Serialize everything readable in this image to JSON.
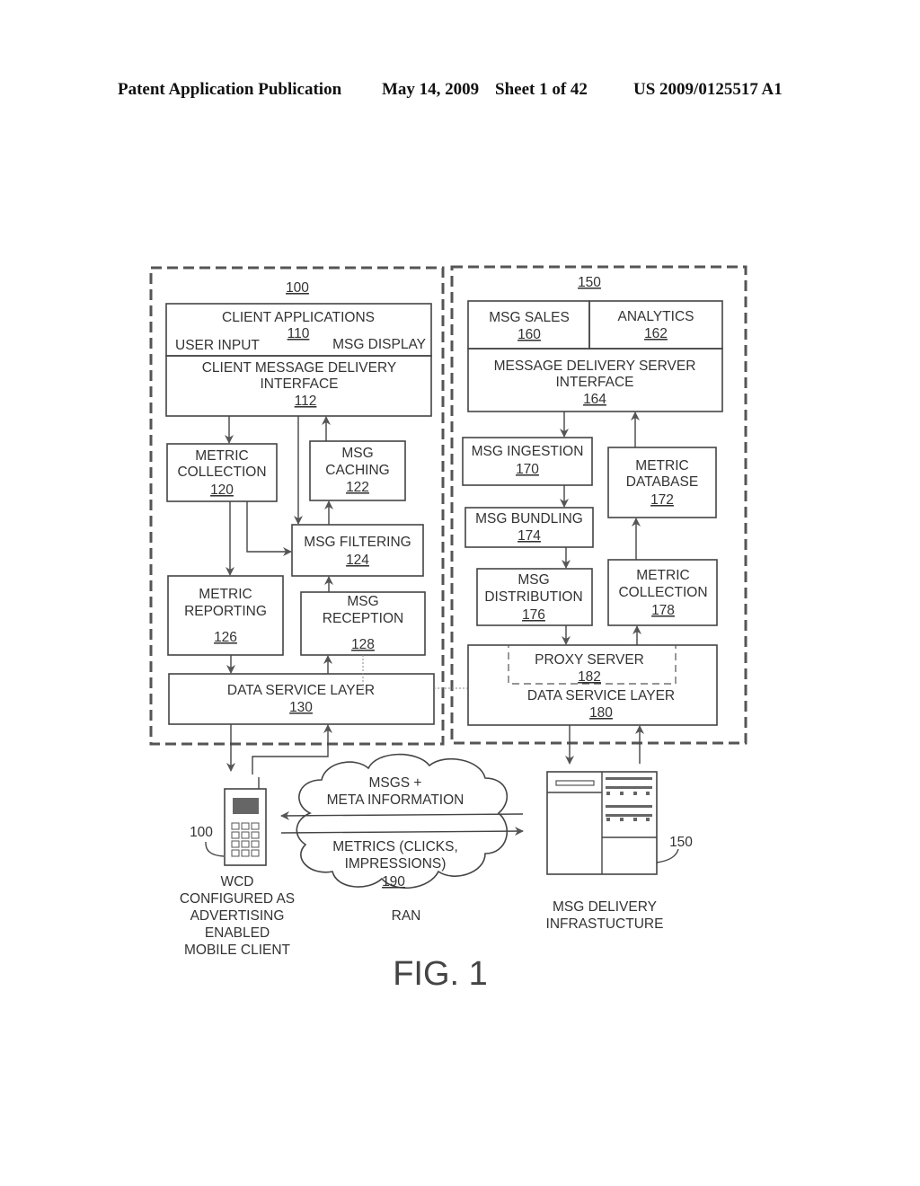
{
  "header": {
    "publication": "Patent Application Publication",
    "date": "May 14, 2009",
    "sheet": "Sheet 1 of 42",
    "number": "US 2009/0125517 A1"
  },
  "client": {
    "ref": "100",
    "apps": {
      "title": "CLIENT APPLICATIONS",
      "ref": "110",
      "left": "USER INPUT",
      "right": "MSG DISPLAY"
    },
    "interface": {
      "line1": "CLIENT MESSAGE DELIVERY",
      "line2": "INTERFACE",
      "ref": "112"
    },
    "metric_collection": {
      "line1": "METRIC",
      "line2": "COLLECTION",
      "ref": "120"
    },
    "msg_caching": {
      "line1": "MSG",
      "line2": "CACHING",
      "ref": "122"
    },
    "msg_filtering": {
      "line1": "MSG FILTERING",
      "ref": "124"
    },
    "metric_reporting": {
      "line1": "METRIC",
      "line2": "REPORTING",
      "ref": "126"
    },
    "msg_reception": {
      "line1": "MSG",
      "line2": "RECEPTION",
      "ref": "128"
    },
    "data_service": {
      "line1": "DATA SERVICE LAYER",
      "ref": "130"
    }
  },
  "server": {
    "ref": "150",
    "msg_sales": {
      "line1": "MSG SALES",
      "ref": "160"
    },
    "analytics": {
      "line1": "ANALYTICS",
      "ref": "162"
    },
    "interface": {
      "line1": "MESSAGE DELIVERY SERVER",
      "line2": "INTERFACE",
      "ref": "164"
    },
    "msg_ingestion": {
      "line1": "MSG INGESTION",
      "ref": "170"
    },
    "metric_database": {
      "line1": "METRIC",
      "line2": "DATABASE",
      "ref": "172"
    },
    "msg_bundling": {
      "line1": "MSG BUNDLING",
      "ref": "174"
    },
    "msg_distribution": {
      "line1": "MSG",
      "line2": "DISTRIBUTION",
      "ref": "176"
    },
    "metric_collection": {
      "line1": "METRIC",
      "line2": "COLLECTION",
      "ref": "178"
    },
    "proxy": {
      "line1": "PROXY SERVER",
      "ref": "182"
    },
    "data_service": {
      "line1": "DATA SERVICE LAYER",
      "ref": "180"
    }
  },
  "network": {
    "upper_line1": "MSGS +",
    "upper_line2": "META INFORMATION",
    "lower_line1": "METRICS (CLICKS,",
    "lower_line2": "IMPRESSIONS)",
    "ref": "190",
    "label": "RAN"
  },
  "device": {
    "ref": "100",
    "caption": [
      "WCD",
      "CONFIGURED AS",
      "ADVERTISING",
      "ENABLED",
      "MOBILE CLIENT"
    ]
  },
  "infrastructure": {
    "ref": "150",
    "caption": [
      "MSG DELIVERY",
      "INFRASTUCTURE"
    ]
  },
  "figure_label": "FIG. 1"
}
